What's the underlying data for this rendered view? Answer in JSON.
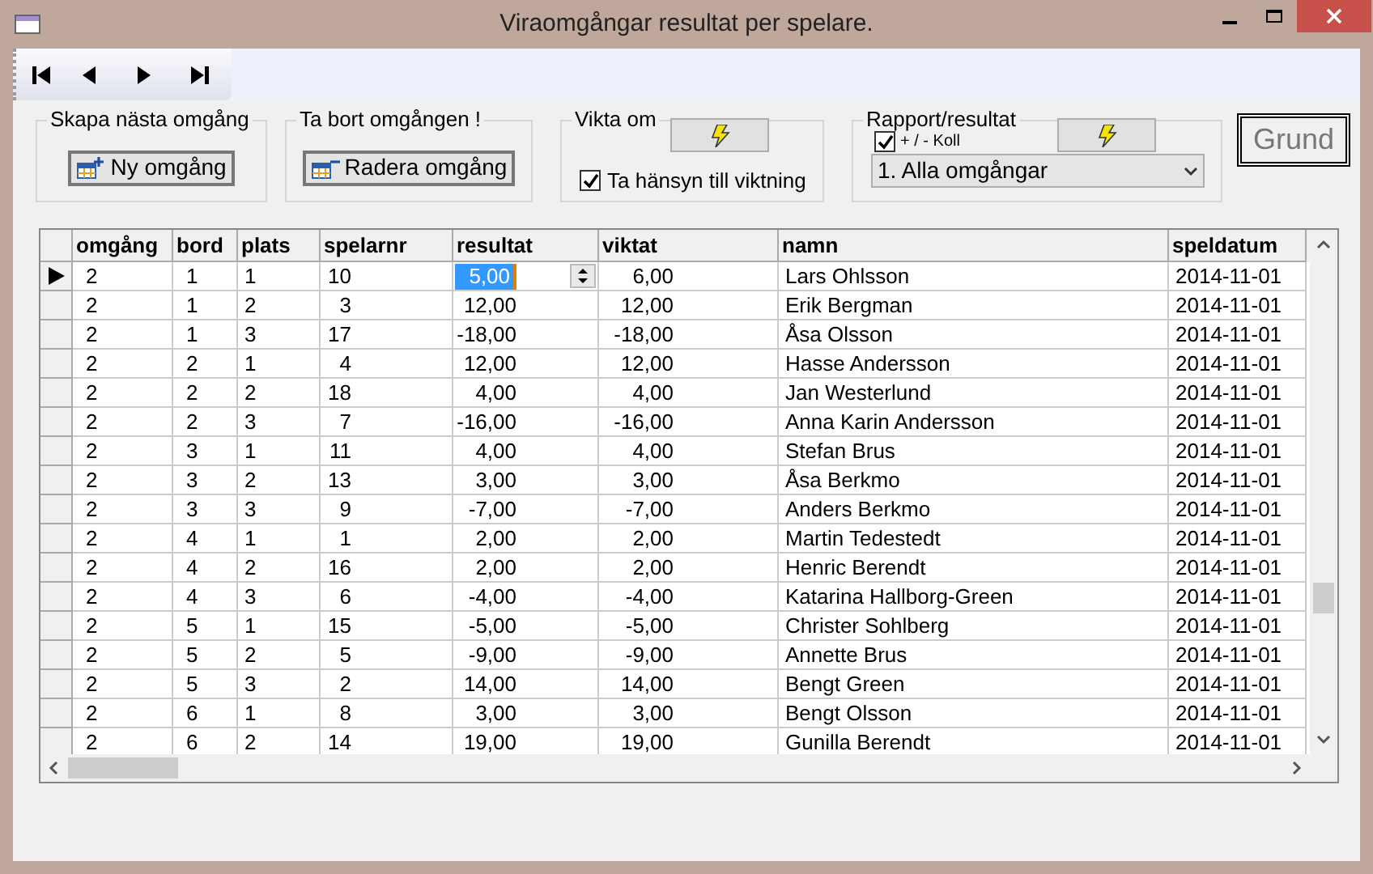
{
  "window": {
    "title": "Viraomgångar resultat per spelare."
  },
  "groups": [
    {
      "title": "Skapa nästa omgång",
      "button": "Ny omgång",
      "kind": "add"
    },
    {
      "title": "Ta bort omgången !",
      "button": "Radera omgång",
      "kind": "remove"
    }
  ],
  "vikta": {
    "title": "Vikta om",
    "checkbox": {
      "label": "Ta hänsyn till viktning",
      "checked": true
    }
  },
  "rapport": {
    "title": "Rapport/resultat",
    "checkbox": {
      "label": "+ / - Koll",
      "checked": true
    },
    "select": {
      "value": "1. Alla omgångar"
    }
  },
  "grund_button": "Grund",
  "table": {
    "columns": [
      "omgång",
      "bord",
      "plats",
      "spelarnr",
      "resultat",
      "viktat",
      "namn",
      "speldatum"
    ],
    "rows": [
      {
        "selected": true,
        "cells": [
          "2",
          "1",
          "1",
          "10",
          "5,00",
          "6,00",
          "Lars Ohlsson",
          "2014-11-01"
        ]
      },
      {
        "selected": false,
        "cells": [
          "2",
          "1",
          "2",
          "3",
          "12,00",
          "12,00",
          "Erik Bergman",
          "2014-11-01"
        ]
      },
      {
        "selected": false,
        "cells": [
          "2",
          "1",
          "3",
          "17",
          "-18,00",
          "-18,00",
          "Åsa Olsson",
          "2014-11-01"
        ]
      },
      {
        "selected": false,
        "cells": [
          "2",
          "2",
          "1",
          "4",
          "12,00",
          "12,00",
          "Hasse Andersson",
          "2014-11-01"
        ]
      },
      {
        "selected": false,
        "cells": [
          "2",
          "2",
          "2",
          "18",
          "4,00",
          "4,00",
          "Jan Westerlund",
          "2014-11-01"
        ]
      },
      {
        "selected": false,
        "cells": [
          "2",
          "2",
          "3",
          "7",
          "-16,00",
          "-16,00",
          "Anna Karin Andersson",
          "2014-11-01"
        ]
      },
      {
        "selected": false,
        "cells": [
          "2",
          "3",
          "1",
          "11",
          "4,00",
          "4,00",
          "Stefan Brus",
          "2014-11-01"
        ]
      },
      {
        "selected": false,
        "cells": [
          "2",
          "3",
          "2",
          "13",
          "3,00",
          "3,00",
          "Åsa Berkmo",
          "2014-11-01"
        ]
      },
      {
        "selected": false,
        "cells": [
          "2",
          "3",
          "3",
          "9",
          "-7,00",
          "-7,00",
          "Anders Berkmo",
          "2014-11-01"
        ]
      },
      {
        "selected": false,
        "cells": [
          "2",
          "4",
          "1",
          "1",
          "2,00",
          "2,00",
          "Martin Tedestedt",
          "2014-11-01"
        ]
      },
      {
        "selected": false,
        "cells": [
          "2",
          "4",
          "2",
          "16",
          "2,00",
          "2,00",
          "Henric Berendt",
          "2014-11-01"
        ]
      },
      {
        "selected": false,
        "cells": [
          "2",
          "4",
          "3",
          "6",
          "-4,00",
          "-4,00",
          "Katarina Hallborg-Green",
          "2014-11-01"
        ]
      },
      {
        "selected": false,
        "cells": [
          "2",
          "5",
          "1",
          "15",
          "-5,00",
          "-5,00",
          "Christer Sohlberg",
          "2014-11-01"
        ]
      },
      {
        "selected": false,
        "cells": [
          "2",
          "5",
          "2",
          "5",
          "-9,00",
          "-9,00",
          "Annette Brus",
          "2014-11-01"
        ]
      },
      {
        "selected": false,
        "cells": [
          "2",
          "5",
          "3",
          "2",
          "14,00",
          "14,00",
          "Bengt Green",
          "2014-11-01"
        ]
      },
      {
        "selected": false,
        "cells": [
          "2",
          "6",
          "1",
          "8",
          "3,00",
          "3,00",
          "Bengt Olsson",
          "2014-11-01"
        ]
      },
      {
        "selected": false,
        "cells": [
          "2",
          "6",
          "2",
          "14",
          "19,00",
          "19,00",
          "Gunilla Berendt",
          "2014-11-01"
        ]
      }
    ]
  }
}
